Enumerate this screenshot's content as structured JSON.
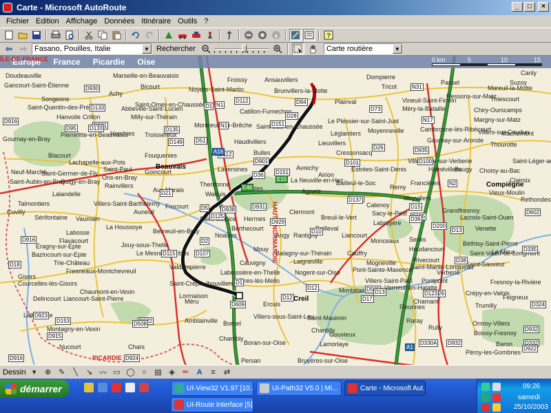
{
  "window": {
    "title": "Carte - Microsoft AutoRoute"
  },
  "menu": [
    "Fichier",
    "Edition",
    "Affichage",
    "Données",
    "Itinéraire",
    "Outils",
    "?"
  ],
  "toolbar2": {
    "location_value": "Fasano, Pouilles, Italie",
    "search_label": "Rechercher",
    "zoom_level": 0.55,
    "map_style_value": "Carte routière"
  },
  "map": {
    "breadcrumb": [
      "Europe",
      "France",
      "Picardie",
      "Oise"
    ],
    "scale": {
      "labels": [
        "0 km",
        "5",
        "10",
        "15"
      ]
    },
    "places": [
      {
        "name": "Doudeauville",
        "type": "town"
      },
      {
        "name": "Gancourt-Saint-Étienne",
        "type": "town"
      },
      {
        "name": "Songeons",
        "type": "town"
      },
      {
        "name": "Saint-Quentin-des-Prés",
        "type": "town"
      },
      {
        "name": "Hanvoile",
        "type": "town"
      },
      {
        "name": "Crillon",
        "type": "town"
      },
      {
        "name": "Gournay-en-Bray",
        "type": "town"
      },
      {
        "name": "Pierrefitte-en-Beauvaisis",
        "type": "town"
      },
      {
        "name": "Blacourt",
        "type": "town"
      },
      {
        "name": "Lachapelle-aux-Pots",
        "type": "town"
      },
      {
        "name": "Saint-Germer-de-Fly",
        "type": "town"
      },
      {
        "name": "Cuigy-en-Bray",
        "type": "town"
      },
      {
        "name": "Neuf-Marché",
        "type": "town"
      },
      {
        "name": "Saint-Aubin-en-Bray",
        "type": "town"
      },
      {
        "name": "Saint-Paul",
        "type": "town"
      },
      {
        "name": "Ons-en-Bray",
        "type": "town"
      },
      {
        "name": "Rainvillers",
        "type": "town"
      },
      {
        "name": "Lalandelle",
        "type": "town"
      },
      {
        "name": "Villers-Saint-Barthélemy",
        "type": "town"
      },
      {
        "name": "Talmontiers",
        "type": "town"
      },
      {
        "name": "Sérifontaine",
        "type": "town"
      },
      {
        "name": "Vaumain",
        "type": "town"
      },
      {
        "name": "La Houssoye",
        "type": "town"
      },
      {
        "name": "Labosse",
        "type": "town"
      },
      {
        "name": "Flavacourt",
        "type": "town"
      },
      {
        "name": "Éragny-sur-Epte",
        "type": "town"
      },
      {
        "name": "Bazincourt-sur-Epte",
        "type": "town"
      },
      {
        "name": "Trie-Château",
        "type": "town"
      },
      {
        "name": "Fresneaux-Montchevreuil",
        "type": "town"
      },
      {
        "name": "Gisors",
        "type": "town"
      },
      {
        "name": "Courcelles-lès-Gisors",
        "type": "town"
      },
      {
        "name": "Chaumont-en-Vexin",
        "type": "town"
      },
      {
        "name": "Delincourt",
        "type": "town"
      },
      {
        "name": "Liancourt-Saint-Pierre",
        "type": "town"
      },
      {
        "name": "Lattainville",
        "type": "town"
      },
      {
        "name": "Montagny-en-Vexin",
        "type": "town"
      },
      {
        "name": "Nucourt",
        "type": "town"
      },
      {
        "name": "Chars",
        "type": "town"
      },
      {
        "name": "Marseille-en-Beauvaisis",
        "type": "town"
      },
      {
        "name": "Bicourt",
        "type": "town"
      },
      {
        "name": "Achy",
        "type": "town"
      },
      {
        "name": "Abbeville-Saint-Lucien",
        "type": "town"
      },
      {
        "name": "Milly-sur-Thérain",
        "type": "town"
      },
      {
        "name": "Herchies",
        "type": "town"
      },
      {
        "name": "Troissereux",
        "type": "town"
      },
      {
        "name": "Fouquenies",
        "type": "town"
      },
      {
        "name": "Goincourt",
        "type": "town"
      },
      {
        "name": "Aux Marais",
        "type": "town"
      },
      {
        "name": "Auneuil",
        "type": "town"
      },
      {
        "name": "Frocourt",
        "type": "town"
      },
      {
        "name": "Berneuil-en-Bray",
        "type": "town"
      },
      {
        "name": "Jouy-sous-Thelle",
        "type": "town"
      },
      {
        "name": "Le Mesnil-Théribus",
        "type": "town"
      },
      {
        "name": "Valdampierre",
        "type": "town"
      },
      {
        "name": "Noyers-Saint-Martin",
        "type": "town"
      },
      {
        "name": "Saint-Omer-en-Chaussée",
        "type": "town"
      },
      {
        "name": "Froissy",
        "type": "town"
      },
      {
        "name": "Montreuil-sur-Brêche",
        "type": "town"
      },
      {
        "name": "Haudivillers",
        "type": "town"
      },
      {
        "name": "Bresles",
        "type": "town"
      },
      {
        "name": "Therdonne",
        "type": "town"
      },
      {
        "name": "Warluis",
        "type": "town"
      },
      {
        "name": "Laversines",
        "type": "town"
      },
      {
        "name": "Saint-Sulpice",
        "type": "town"
      },
      {
        "name": "Berthecourt",
        "type": "town"
      },
      {
        "name": "Hermes",
        "type": "town"
      },
      {
        "name": "Noailles",
        "type": "town"
      },
      {
        "name": "Mouy",
        "type": "town"
      },
      {
        "name": "Cauvigny",
        "type": "town"
      },
      {
        "name": "Laboissière-en-Thelle",
        "type": "town"
      },
      {
        "name": "Cires-lès-Mello",
        "type": "town"
      },
      {
        "name": "Saint-Crépin-Ibouvillers",
        "type": "town"
      },
      {
        "name": "Lormaison",
        "type": "town"
      },
      {
        "name": "Méru",
        "type": "town"
      },
      {
        "name": "Amblainville",
        "type": "town"
      },
      {
        "name": "Bornel",
        "type": "town"
      },
      {
        "name": "Chambly",
        "type": "town"
      },
      {
        "name": "Boran-sur-Oise",
        "type": "town"
      },
      {
        "name": "Persan",
        "type": "town"
      },
      {
        "name": "Bruyères-sur-Oise",
        "type": "town"
      },
      {
        "name": "Ansauvillers",
        "type": "town"
      },
      {
        "name": "Brunvillers-la-Motte",
        "type": "town"
      },
      {
        "name": "Catillon-Fumechon",
        "type": "town"
      },
      {
        "name": "Saint-Just-en-Chaussée",
        "type": "town"
      },
      {
        "name": "Bulles",
        "type": "town"
      },
      {
        "name": "La Neuville-en-Hez",
        "type": "town"
      },
      {
        "name": "Agnetz",
        "type": "town"
      },
      {
        "name": "Clermont",
        "type": "town"
      },
      {
        "name": "Breuil-le-Vert",
        "type": "town"
      },
      {
        "name": "Bailleval",
        "type": "town"
      },
      {
        "name": "Angy",
        "type": "town"
      },
      {
        "name": "Rantigny",
        "type": "town"
      },
      {
        "name": "Balagny-sur-Thérain",
        "type": "town"
      },
      {
        "name": "Laigneville",
        "type": "town"
      },
      {
        "name": "Nogent-sur-Oise",
        "type": "town"
      },
      {
        "name": "Montataire",
        "type": "town"
      },
      {
        "name": "Creil",
        "type": "city"
      },
      {
        "name": "Ercuis",
        "type": "town"
      },
      {
        "name": "Villers-sous-Saint-Leu",
        "type": "town"
      },
      {
        "name": "Saint-Maximin",
        "type": "town"
      },
      {
        "name": "Chantilly",
        "type": "town"
      },
      {
        "name": "Gouvieux",
        "type": "town"
      },
      {
        "name": "Lamorlaye",
        "type": "town"
      },
      {
        "name": "Beauvais",
        "type": "city"
      },
      {
        "name": "Compiègne",
        "type": "city"
      },
      {
        "name": "Dompierre",
        "type": "town"
      },
      {
        "name": "Tricot",
        "type": "town"
      },
      {
        "name": "Plainval",
        "type": "town"
      },
      {
        "name": "Le Plessier-sur-Saint-Just",
        "type": "town"
      },
      {
        "name": "Léglantiers",
        "type": "town"
      },
      {
        "name": "Moyenneville",
        "type": "town"
      },
      {
        "name": "Lieuvillers",
        "type": "town"
      },
      {
        "name": "Cressonsacq",
        "type": "town"
      },
      {
        "name": "Estrées-Saint-Denis",
        "type": "town"
      },
      {
        "name": "Avrechy",
        "type": "town"
      },
      {
        "name": "Airion",
        "type": "town"
      },
      {
        "name": "Bailleul-le-Soc",
        "type": "town"
      },
      {
        "name": "Catenoy",
        "type": "town"
      },
      {
        "name": "Sacy-le-Petit",
        "type": "town"
      },
      {
        "name": "Labruyère",
        "type": "town"
      },
      {
        "name": "Liancourt",
        "type": "town"
      },
      {
        "name": "Monceaux",
        "type": "town"
      },
      {
        "name": "Cauffry",
        "type": "town"
      },
      {
        "name": "Mogneville",
        "type": "town"
      },
      {
        "name": "Pont-Sainte-Maxence",
        "type": "town"
      },
      {
        "name": "Villers-Saint-Paul",
        "type": "town"
      },
      {
        "name": "Verneuil-en-Halatte",
        "type": "town"
      },
      {
        "name": "Fleurines",
        "type": "town"
      },
      {
        "name": "Vineuil-Saint-Firmin",
        "type": "town"
      },
      {
        "name": "Méry-la-Bataille",
        "type": "town"
      },
      {
        "name": "Ressons-sur-Matz",
        "type": "town"
      },
      {
        "name": "Mareuil-la-Motte",
        "type": "town"
      },
      {
        "name": "Thiescourt",
        "type": "town"
      },
      {
        "name": "Chiry-Ourscamps",
        "type": "town"
      },
      {
        "name": "Margny-sur-Matz",
        "type": "town"
      },
      {
        "name": "Cambronne-lès-Ribécourt",
        "type": "town"
      },
      {
        "name": "Gournay-sur-Aronde",
        "type": "town"
      },
      {
        "name": "Villers-sur-Coudun",
        "type": "town"
      },
      {
        "name": "Machemont",
        "type": "town"
      },
      {
        "name": "Thourotte",
        "type": "town"
      },
      {
        "name": "Saint-Léger-aux-Bois",
        "type": "town"
      },
      {
        "name": "Choisy-au-Bac",
        "type": "town"
      },
      {
        "name": "Clairoix",
        "type": "town"
      },
      {
        "name": "Rethondes",
        "type": "town"
      },
      {
        "name": "Vieux-Moulin",
        "type": "town"
      },
      {
        "name": "Venette",
        "type": "town"
      },
      {
        "name": "Lacroix-Saint-Ouen",
        "type": "town"
      },
      {
        "name": "Le Meux",
        "type": "town"
      },
      {
        "name": "Béthisy-Saint-Pierre",
        "type": "town"
      },
      {
        "name": "Saint-Sauveur",
        "type": "town"
      },
      {
        "name": "Saint-Vaast-de-Longmont",
        "type": "town"
      },
      {
        "name": "Verberie",
        "type": "town"
      },
      {
        "name": "Fresnoy-la-Rivière",
        "type": "town"
      },
      {
        "name": "Feigneux",
        "type": "town"
      },
      {
        "name": "Crépy-en-Valois",
        "type": "town"
      },
      {
        "name": "Trumilly",
        "type": "town"
      },
      {
        "name": "Ormoy-Villers",
        "type": "town"
      },
      {
        "name": "Boissy-Fresnoy",
        "type": "town"
      },
      {
        "name": "Baron",
        "type": "town"
      },
      {
        "name": "Péroy-les-Gombries",
        "type": "town"
      },
      {
        "name": "Rully",
        "type": "town"
      },
      {
        "name": "Raray",
        "type": "town"
      },
      {
        "name": "Chamant",
        "type": "town"
      },
      {
        "name": "Senlis",
        "type": "town"
      },
      {
        "name": "Houdancourt",
        "type": "town"
      },
      {
        "name": "Rivecourt",
        "type": "town"
      },
      {
        "name": "Saint-Martin-Longueau",
        "type": "town"
      },
      {
        "name": "Pontpoint",
        "type": "town"
      },
      {
        "name": "Villeneuve-sur-Verberie",
        "type": "town"
      },
      {
        "name": "Francières",
        "type": "town"
      },
      {
        "name": "Hémévillers",
        "type": "town"
      },
      {
        "name": "Baugy",
        "type": "town"
      },
      {
        "name": "Remy",
        "type": "town"
      },
      {
        "name": "Moyvillers",
        "type": "town"
      },
      {
        "name": "Grandfresnoy",
        "type": "town"
      },
      {
        "name": "Canly",
        "type": "town"
      },
      {
        "name": "Suzoy",
        "type": "town"
      },
      {
        "name": "Passel",
        "type": "town"
      },
      {
        "name": "Cuvilly",
        "type": "town"
      },
      {
        "name": "HAUTE-NORMANDIE",
        "type": "region"
      },
      {
        "name": "PICARDIE",
        "type": "region"
      },
      {
        "name": "ÎLE-DE-FRANCE",
        "type": "region"
      }
    ],
    "roads": [
      "D930",
      "D133",
      "D1",
      "N1",
      "D112",
      "D94",
      "D916",
      "D151",
      "D931",
      "D73",
      "D28",
      "D133",
      "D95",
      "D135",
      "D149",
      "D51",
      "D901",
      "D151",
      "D101",
      "D26",
      "D112",
      "D36",
      "D938",
      "D931",
      "D21",
      "D5",
      "D125",
      "D929",
      "D12",
      "D916",
      "D18",
      "D10",
      "D137",
      "D115",
      "D107",
      "D2",
      "D609",
      "D1",
      "D12",
      "D565",
      "D17",
      "D923",
      "D922",
      "D508",
      "D153",
      "D915",
      "D916",
      "D924",
      "D929",
      "D15",
      "D155",
      "D137",
      "D36",
      "D200",
      "D13",
      "D38",
      "D602",
      "D335",
      "D13",
      "D26",
      "D123",
      "D100",
      "D935",
      "D932",
      "D332",
      "D922",
      "D324",
      "N2",
      "N17",
      "N31",
      "N1",
      "A1",
      "A16",
      "E46",
      "E15",
      "D330A",
      "D932"
    ],
    "route": {
      "start": "Brunvillers-la-Motte",
      "end": "Cires-lès-Mello"
    }
  },
  "drawbar": {
    "label": "Dessin"
  },
  "taskbar": {
    "start_label": "démarrer",
    "tasks": [
      {
        "label": "UI-View32 V1.97 [10..."
      },
      {
        "label": "UI-Path32  V5.0  | Mi..."
      },
      {
        "label": "Carte - Microsoft Aut..."
      },
      {
        "label": "UI-Route Interface [5]"
      }
    ],
    "clock": "09:26",
    "day": "samedi",
    "date": "25/10/2003"
  },
  "colors": {
    "titlebar": "#0a246a",
    "map_bg": "#f4efdc",
    "route": "#111111",
    "route_start": "#cc0000",
    "motorway": "#3b9b3b",
    "national_road": "#d8312b",
    "departmental_road": "#e9c43c",
    "forest": "#b8d7a6",
    "water": "#7aaee8",
    "region_border": "#cc2222"
  }
}
